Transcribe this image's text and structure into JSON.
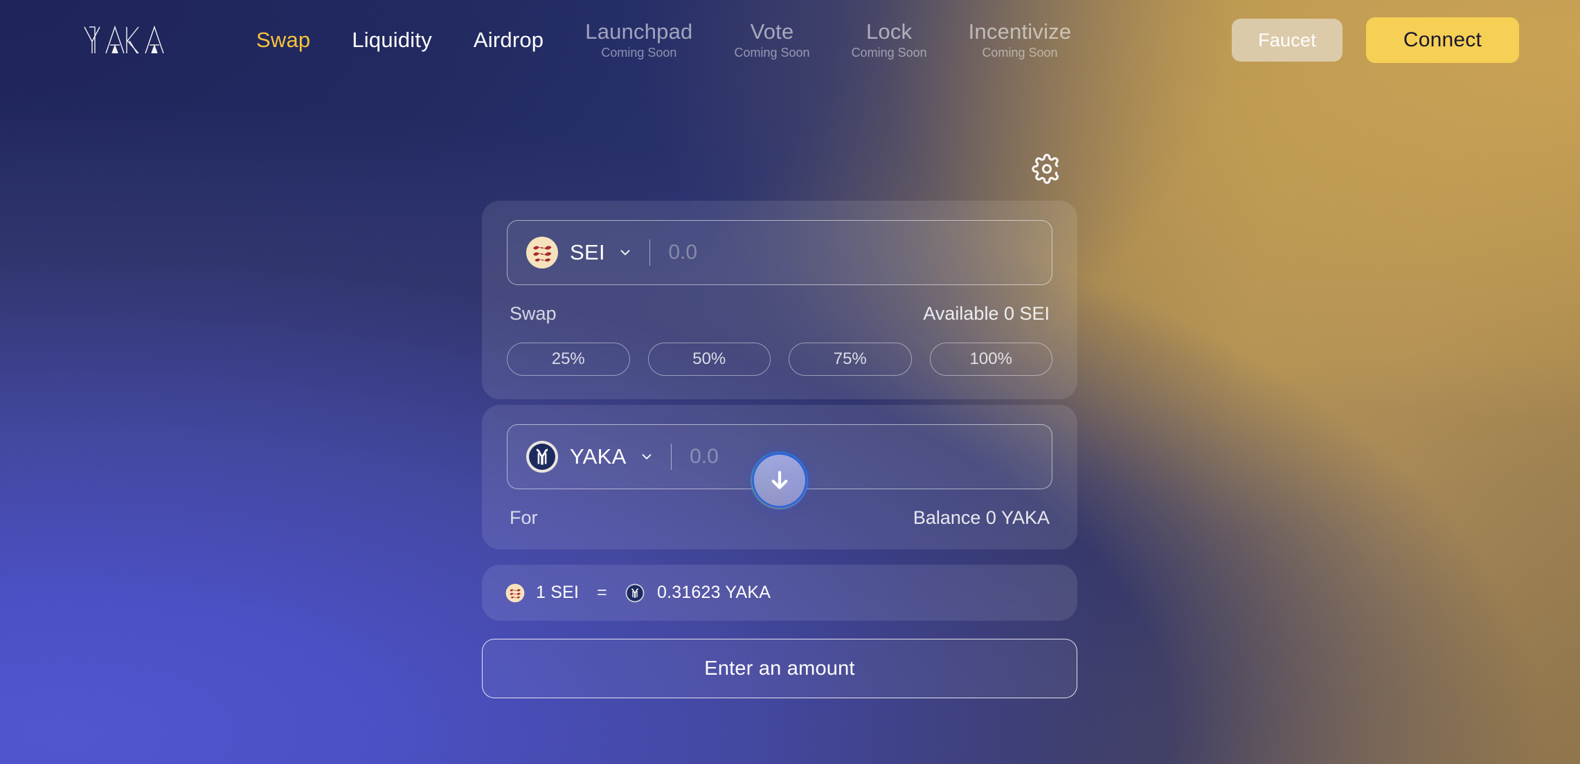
{
  "brand": {
    "logo_text": "YAKA",
    "logo_name": "yaka-logo"
  },
  "nav": {
    "items": [
      {
        "label": "Swap",
        "sub": "",
        "state": "active"
      },
      {
        "label": "Liquidity",
        "sub": "",
        "state": "plain"
      },
      {
        "label": "Airdrop",
        "sub": "",
        "state": "plain"
      },
      {
        "label": "Launchpad",
        "sub": "Coming Soon",
        "state": "soon"
      },
      {
        "label": "Vote",
        "sub": "Coming Soon",
        "state": "soon"
      },
      {
        "label": "Lock",
        "sub": "Coming Soon",
        "state": "soon"
      },
      {
        "label": "Incentivize",
        "sub": "Coming Soon",
        "state": "soon"
      }
    ]
  },
  "header_actions": {
    "faucet_label": "Faucet",
    "connect_label": "Connect"
  },
  "swap": {
    "settings_icon": "gear-icon",
    "from": {
      "token_symbol": "SEI",
      "token_icon": "sei-token-icon",
      "amount_value": "",
      "amount_placeholder": "0.0",
      "action_label": "Swap",
      "balance_label": "Available 0 SEI"
    },
    "percent_buttons": [
      "25%",
      "50%",
      "75%",
      "100%"
    ],
    "swap_direction_icon": "arrow-down-icon",
    "to": {
      "token_symbol": "YAKA",
      "token_icon": "yaka-token-icon",
      "amount_value": "",
      "amount_placeholder": "0.0",
      "action_label": "For",
      "balance_label": "Balance 0 YAKA"
    },
    "rate": {
      "from_amount_label": "1 SEI",
      "equals": "=",
      "to_amount_label": "0.31623 YAKA",
      "from_icon": "sei-token-icon",
      "to_icon": "yaka-token-icon"
    },
    "cta_label": "Enter an amount"
  },
  "colors": {
    "accent_yellow": "#f6cf55",
    "nav_active": "#f5c33b",
    "bg_navy": "#20275c",
    "bg_blue_violet": "#4c51be",
    "bg_tan": "#bd9a57",
    "sei_red": "#a8282f",
    "sei_cream": "#f6e3bd",
    "yaka_navy": "#1c2a5e"
  }
}
